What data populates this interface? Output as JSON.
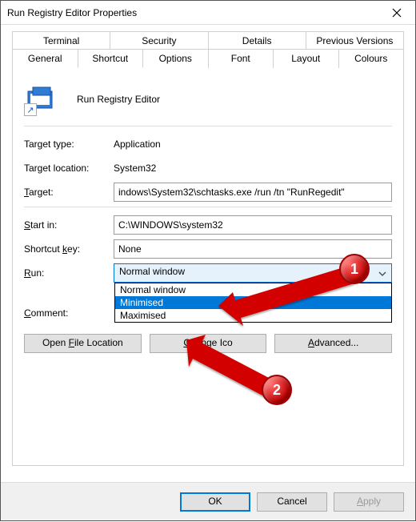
{
  "window": {
    "title": "Run Registry Editor Properties"
  },
  "tabs_row1": [
    {
      "label": "Terminal"
    },
    {
      "label": "Security"
    },
    {
      "label": "Details"
    },
    {
      "label": "Previous Versions"
    }
  ],
  "tabs_row2": [
    {
      "label": "General"
    },
    {
      "label": "Shortcut",
      "active": true
    },
    {
      "label": "Options"
    },
    {
      "label": "Font"
    },
    {
      "label": "Layout"
    },
    {
      "label": "Colours"
    }
  ],
  "shortcut": {
    "app_name": "Run Registry Editor",
    "target_type_label": "Target type:",
    "target_type_value": "Application",
    "target_location_label": "Target location:",
    "target_location_value": "System32",
    "target_label_pre": "T",
    "target_label_post": "arget:",
    "target_value": "indows\\System32\\schtasks.exe /run /tn \"RunRegedit\"",
    "start_in_label_pre": "S",
    "start_in_label_post": "tart in:",
    "start_in_value": "C:\\WINDOWS\\system32",
    "shortcut_key_label_pre": "Shortcut ",
    "shortcut_key_label_u": "k",
    "shortcut_key_label_post": "ey:",
    "shortcut_key_value": "None",
    "run_label_pre": "R",
    "run_label_post": "un:",
    "run_selected": "Normal window",
    "run_options": [
      "Normal window",
      "Minimised",
      "Maximised"
    ],
    "run_highlight_index": 1,
    "comment_label_pre": "C",
    "comment_label_post": "omment:",
    "btn_open_pre": "Open ",
    "btn_open_u": "F",
    "btn_open_post": "ile Location",
    "btn_change_pre": "C",
    "btn_change_post": "hange Ico",
    "btn_adv_pre": "A",
    "btn_adv_post": "dvanced..."
  },
  "dialog_buttons": {
    "ok": "OK",
    "cancel": "Cancel",
    "apply_pre": "A",
    "apply_post": "pply"
  },
  "annotations": {
    "badge1": "1",
    "badge2": "2"
  }
}
